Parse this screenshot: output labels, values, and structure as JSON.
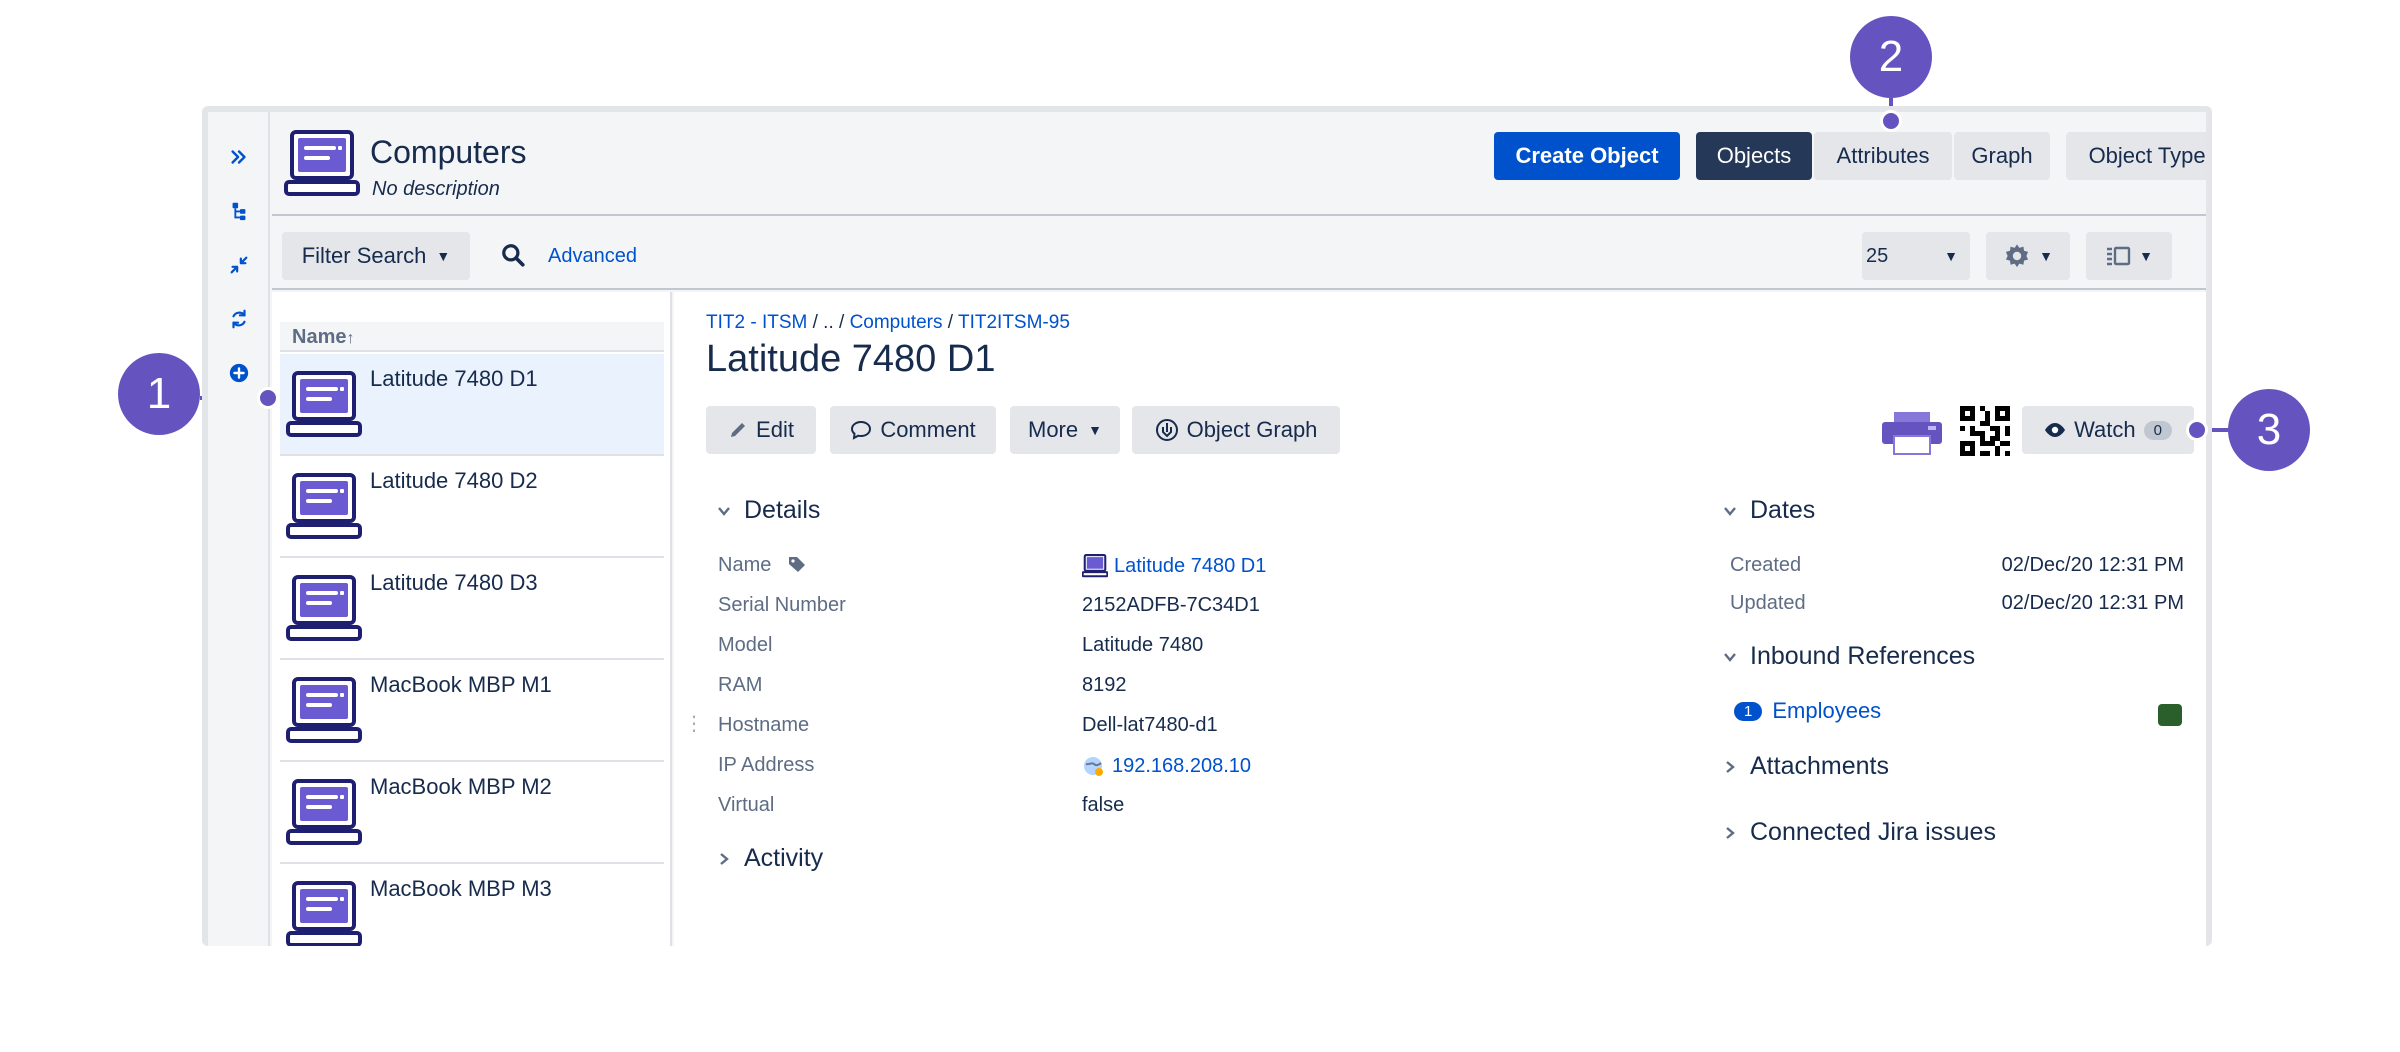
{
  "header": {
    "title": "Computers",
    "description": "No description",
    "create_button": "Create Object",
    "tabs": [
      "Objects",
      "Attributes",
      "Graph"
    ],
    "object_type": "Object Type"
  },
  "toolbar": {
    "filter_search": "Filter Search",
    "advanced": "Advanced",
    "page_size": "25"
  },
  "list": {
    "column_header": "Name",
    "sort_indicator": "↑",
    "items": [
      {
        "label": "Latitude 7480 D1",
        "selected": true
      },
      {
        "label": "Latitude 7480 D2",
        "selected": false
      },
      {
        "label": "Latitude 7480 D3",
        "selected": false
      },
      {
        "label": "MacBook MBP M1",
        "selected": false
      },
      {
        "label": "MacBook MBP M2",
        "selected": false
      },
      {
        "label": "MacBook MBP M3",
        "selected": false
      }
    ]
  },
  "detail": {
    "breadcrumb": {
      "root": "TIT2 - ITSM",
      "ellipsis": " / .. / ",
      "type": "Computers",
      "sep": " / ",
      "key": "TIT2ITSM-95"
    },
    "title": "Latitude 7480 D1",
    "actions": {
      "edit": "Edit",
      "comment": "Comment",
      "more": "More",
      "object_graph": "Object Graph",
      "watch": "Watch",
      "watch_count": "0"
    },
    "details_heading": "Details",
    "attributes": [
      {
        "label": "Name",
        "value": "Latitude 7480 D1"
      },
      {
        "label": "Serial Number",
        "value": "2152ADFB-7C34D1"
      },
      {
        "label": "Model",
        "value": "Latitude 7480"
      },
      {
        "label": "RAM",
        "value": "8192"
      },
      {
        "label": "Hostname",
        "value": "Dell-lat7480-d1"
      },
      {
        "label": "IP Address",
        "value": "192.168.208.10"
      },
      {
        "label": "Virtual",
        "value": "false"
      }
    ],
    "activity_heading": "Activity",
    "dates_heading": "Dates",
    "dates": [
      {
        "label": "Created",
        "value": "02/Dec/20 12:31 PM"
      },
      {
        "label": "Updated",
        "value": "02/Dec/20 12:31 PM"
      }
    ],
    "inbound_heading": "Inbound References",
    "inbound": {
      "count": "1",
      "label": "Employees",
      "color": "#2a5e2a"
    },
    "attachments_heading": "Attachments",
    "jira_heading": "Connected Jira issues"
  },
  "annotations": [
    "1",
    "2",
    "3"
  ],
  "colors": {
    "accent": "#0052cc",
    "annotation": "#6554c0",
    "icon": "#5243aa",
    "dark_tab": "#253858"
  }
}
